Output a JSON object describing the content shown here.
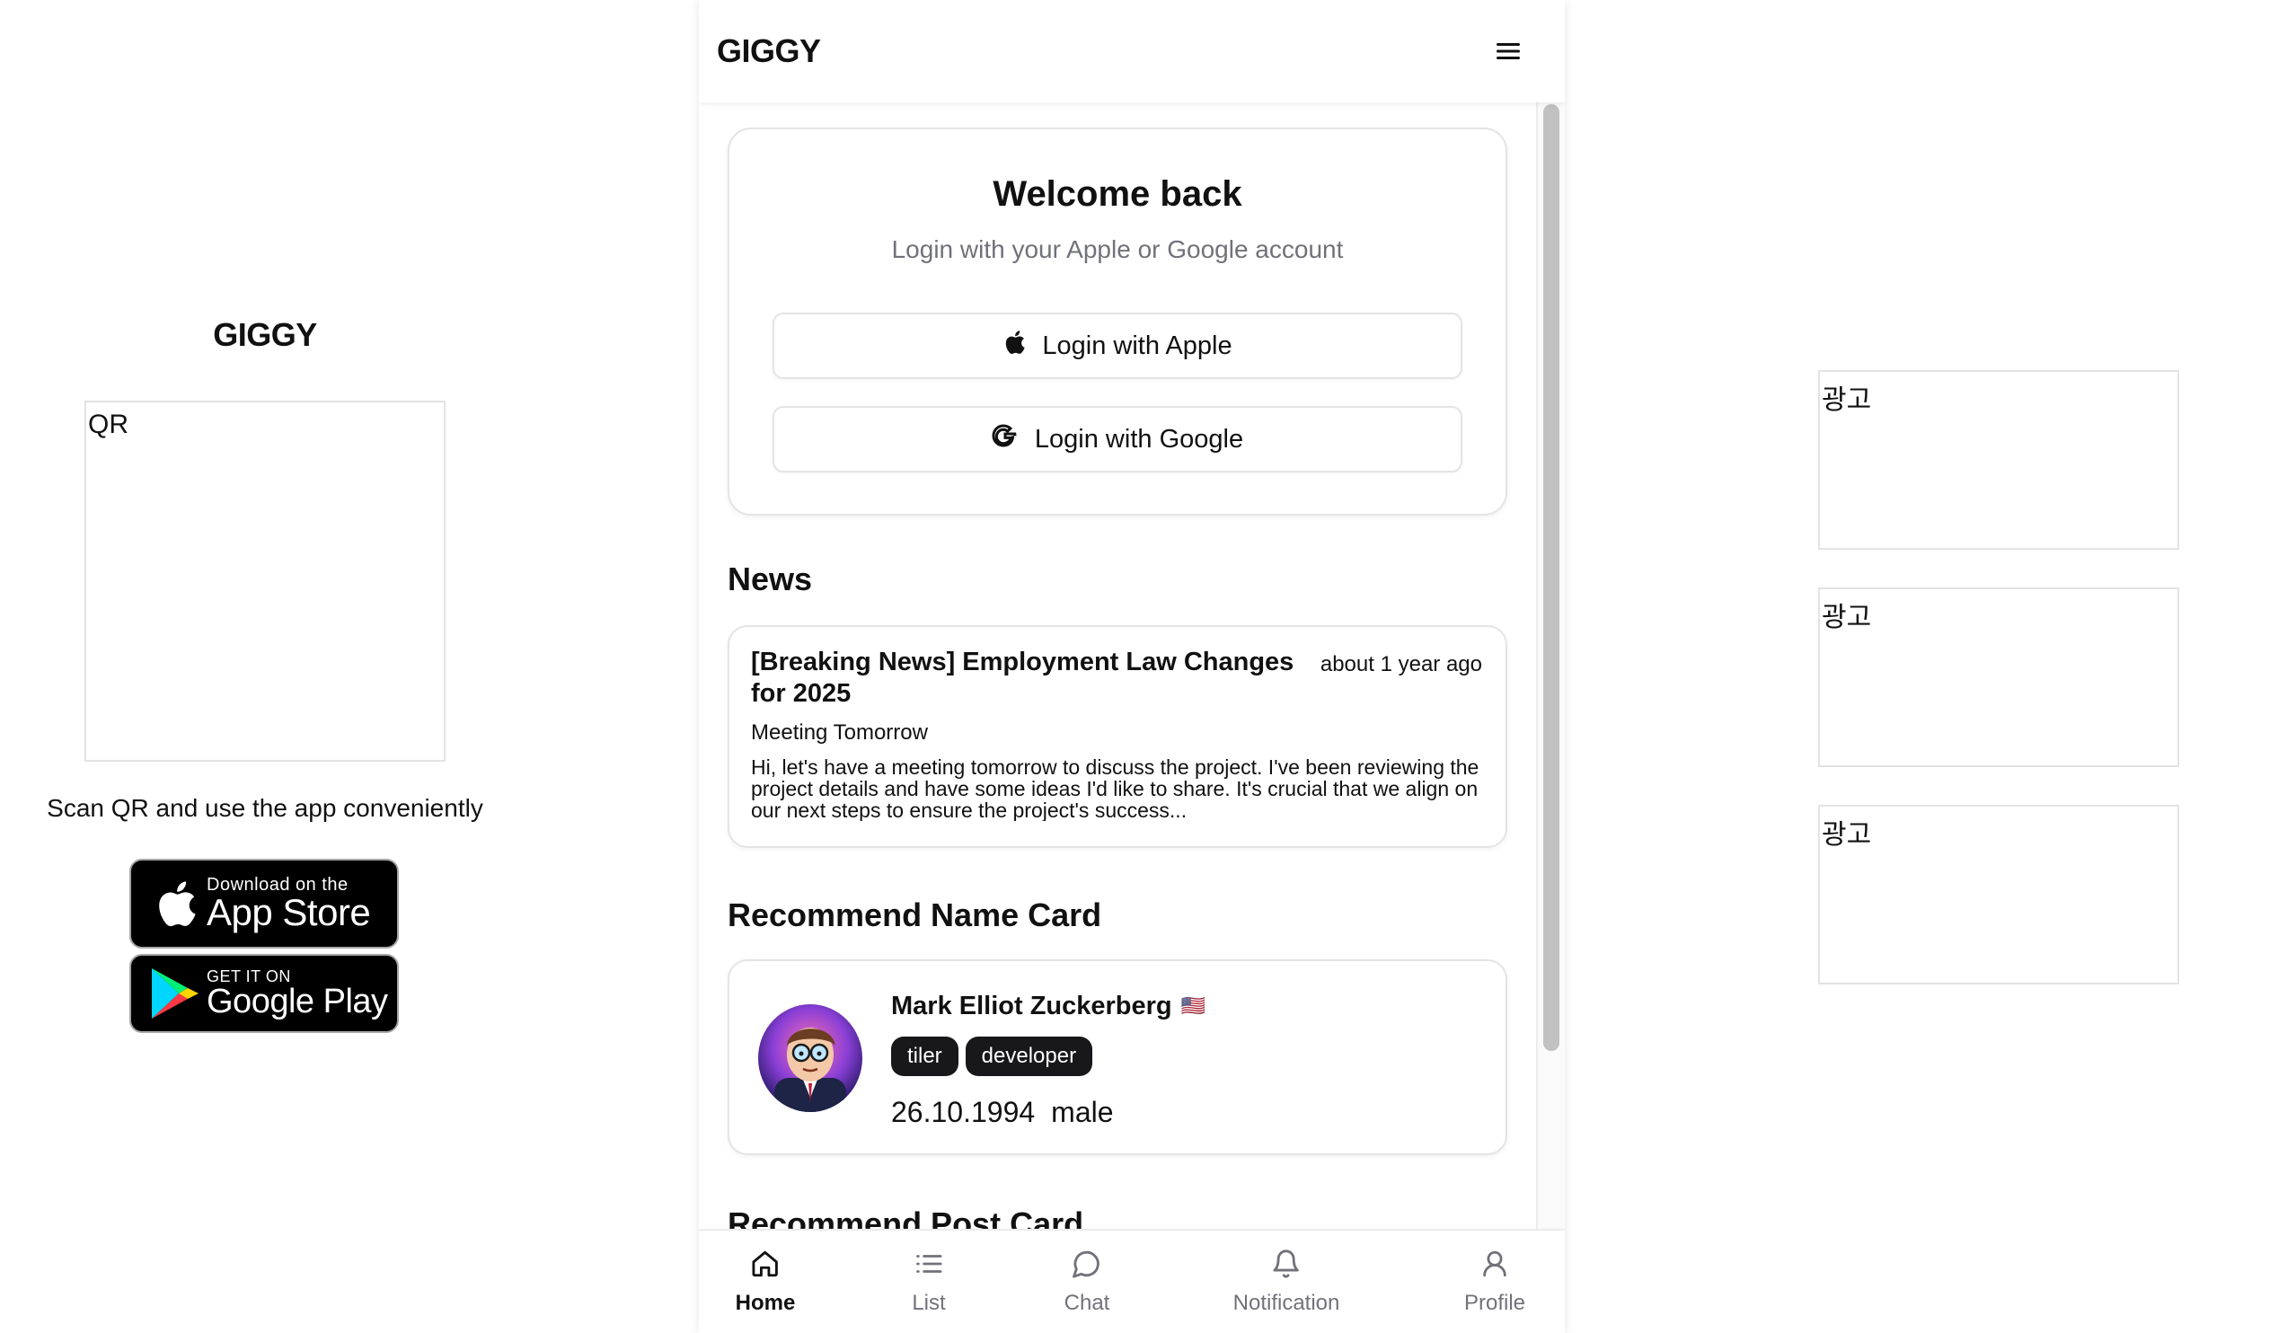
{
  "left_panel": {
    "brand": "GIGGY",
    "qr_label": "QR",
    "scan_text": "Scan QR and use the app conveniently",
    "app_store": {
      "small": "Download on the",
      "big": "App Store"
    },
    "google_play": {
      "small": "GET IT ON",
      "big": "Google Play"
    }
  },
  "ads": [
    {
      "label": "광고"
    },
    {
      "label": "광고"
    },
    {
      "label": "광고"
    }
  ],
  "header": {
    "logo": "GIGGY",
    "menu_icon": "hamburger-menu-icon"
  },
  "login": {
    "title": "Welcome back",
    "subtitle": "Login with your Apple or Google account",
    "apple_label": "Login with Apple",
    "google_label": "Login with Google"
  },
  "news": {
    "section_title": "News",
    "items": [
      {
        "title": "[Breaking News] Employment Law Changes for 2025",
        "time": "about 1 year ago",
        "subtitle": "Meeting Tomorrow",
        "body": "Hi, let's have a meeting tomorrow to discuss the project. I've been reviewing the project details and have some ideas I'd like to share. It's crucial that we align on our next steps to ensure the project's success..."
      }
    ]
  },
  "name_card": {
    "section_title": "Recommend Name Card",
    "name": "Mark Elliot Zuckerberg",
    "flag": "🇺🇸",
    "tags": [
      "tiler",
      "developer"
    ],
    "birthdate": "26.10.1994",
    "gender": "male"
  },
  "post_card": {
    "section_title": "Recommend Post Card"
  },
  "bottom_nav": {
    "items": [
      {
        "label": "Home",
        "icon": "home-icon",
        "active": true
      },
      {
        "label": "List",
        "icon": "list-icon",
        "active": false
      },
      {
        "label": "Chat",
        "icon": "chat-icon",
        "active": false
      },
      {
        "label": "Notification",
        "icon": "bell-icon",
        "active": false
      },
      {
        "label": "Profile",
        "icon": "user-icon",
        "active": false
      }
    ]
  },
  "colors": {
    "accent": "#18181b",
    "muted": "#71717a",
    "border": "#e4e4e7"
  }
}
